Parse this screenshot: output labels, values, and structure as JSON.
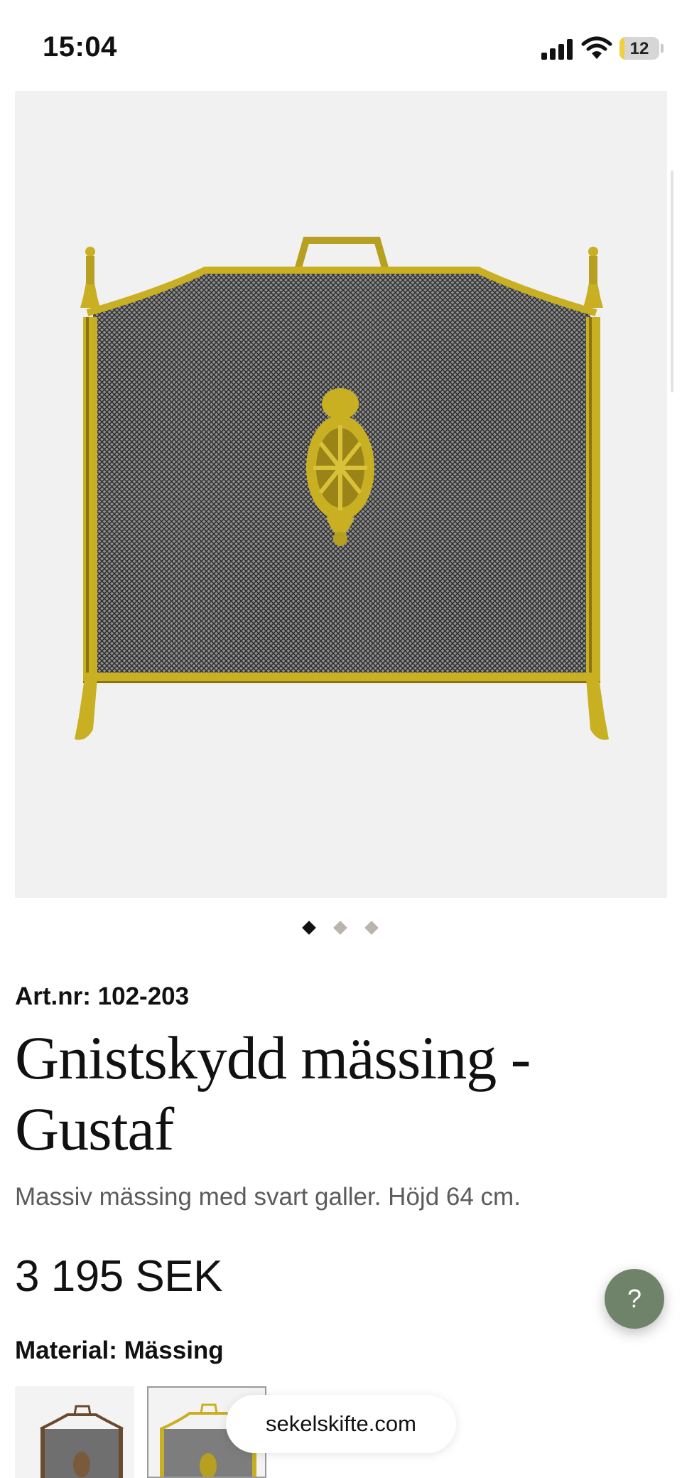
{
  "status_bar": {
    "time": "15:04",
    "battery_level": "12",
    "battery_fraction": 0.12,
    "icons": [
      "cellular-signal-icon",
      "wifi-icon",
      "battery-icon"
    ]
  },
  "gallery": {
    "image_alt": "Gnistskydd mässing - Gustaf",
    "slide_count": 3,
    "active_slide": 1
  },
  "product": {
    "article_number": "Art.nr: 102-203",
    "title": "Gnistskydd mässing - Gustaf",
    "description": "Massiv mässing med svart galler. Höjd 64 cm.",
    "price": "3 195 SEK",
    "material_label": "Material: Mässing",
    "selected_variant": 2
  },
  "help_button": {
    "label": "?"
  },
  "browser": {
    "url": "sekelskifte.com"
  },
  "colors": {
    "accent_green": "#6e836a",
    "brass": "#c8b022",
    "text_primary": "#111111",
    "text_secondary": "#5b5b5b",
    "dot_inactive": "#b9b4ae"
  }
}
